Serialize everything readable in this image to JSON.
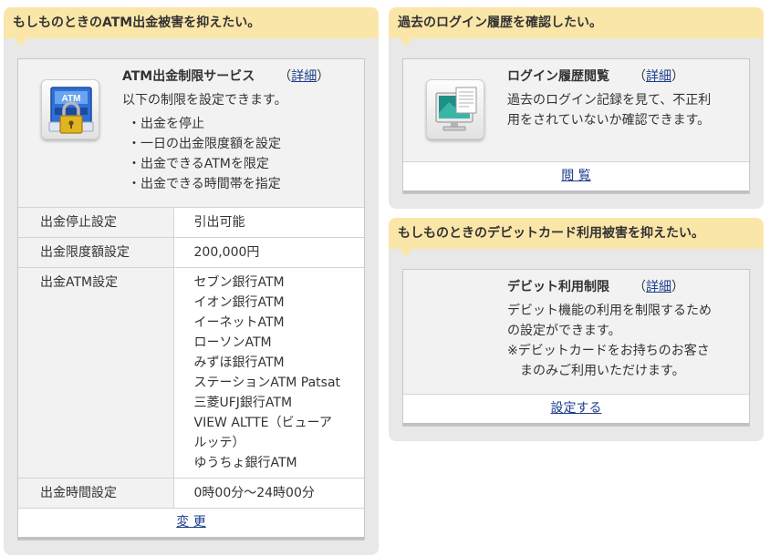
{
  "atm": {
    "header": "もしものときのATM出金被害を抑えたい。",
    "icon_label": "ATM",
    "title": "ATM出金制限サービス",
    "detail_open": "（",
    "detail_link": "詳細",
    "detail_close": "）",
    "description": "以下の制限を設定できます。",
    "bullets": [
      "・出金を停止",
      "・一日の出金限度額を設定",
      "・出金できるATMを限定",
      "・出金できる時間帯を指定"
    ],
    "rows": [
      {
        "label": "出金停止設定",
        "value": "引出可能"
      },
      {
        "label": "出金限度額設定",
        "value": "200,000円"
      }
    ],
    "atm_row_label": "出金ATM設定",
    "atm_list": [
      "セブン銀行ATM",
      "イオン銀行ATM",
      "イーネットATM",
      "ローソンATM",
      "みずほ銀行ATM",
      "ステーションATM Patsat",
      "三菱UFJ銀行ATM",
      "VIEW ALTTE（ビューア",
      "ルッテ）",
      "ゆうちょ銀行ATM"
    ],
    "time_row_label": "出金時間設定",
    "time_row_value": "0時00分〜24時00分",
    "action": "変 更"
  },
  "login": {
    "header": "過去のログイン履歴を確認したい。",
    "title": "ログイン履歴閲覧",
    "detail_open": "（",
    "detail_link": "詳細",
    "detail_close": "）",
    "description": [
      "過去のログイン記録を見て、不正利",
      "用をされていないか確認できます。"
    ],
    "action": "閲 覧"
  },
  "debit": {
    "header": "もしものときのデビットカード利用被害を抑えたい。",
    "title": "デビット利用制限",
    "detail_open": "（",
    "detail_link": "詳細",
    "detail_close": "）",
    "description": [
      "デビット機能の利用を制限するため",
      "の設定ができます。",
      "※デビットカードをお持ちのお客さ",
      "　まのみご利用いただけます。"
    ],
    "action": "設定する"
  },
  "colors": {
    "header_bg": "#fbe6a9",
    "panel_bg": "#e8e8e8",
    "link": "#1a3d8c",
    "atm_icon_blue": "#2f6fd6",
    "lock_gold": "#e0b422"
  }
}
